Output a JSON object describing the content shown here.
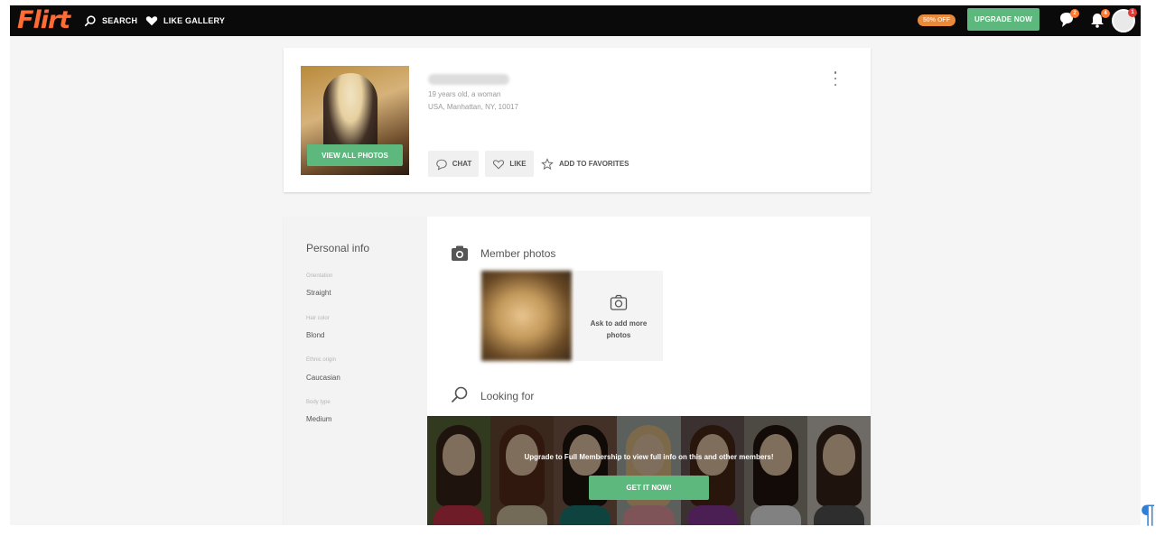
{
  "topbar": {
    "logo_text": "Flirt",
    "nav": [
      {
        "label": "SEARCH",
        "icon": "search-icon"
      },
      {
        "label": "LIKE GALLERY",
        "icon": "heart-icon"
      }
    ],
    "promo_badge": "50% OFF",
    "upgrade_label": "UPGRADE NOW",
    "messages_count": "2",
    "notifications_count": "4",
    "profile_badge": "1",
    "brand_color": "#ff6b35",
    "accent_color": "#5cb87c"
  },
  "profile": {
    "view_photos_label": "VIEW ALL PHOTOS",
    "age_line": "19 years old, a woman",
    "location_line": "USA, Manhattan, NY, 10017",
    "actions": {
      "chat_label": "CHAT",
      "like_label": "LIKE",
      "favorites_label": "ADD TO FAVORITES"
    }
  },
  "personal_info": {
    "title": "Personal info",
    "fields": [
      {
        "label": "Orientation",
        "value": "Straight"
      },
      {
        "label": "Hair color",
        "value": "Blond"
      },
      {
        "label": "Ethnic origin",
        "value": "Caucasian"
      },
      {
        "label": "Body type",
        "value": "Medium"
      }
    ]
  },
  "member_photos": {
    "title": "Member photos",
    "ask_text": "Ask to add more photos"
  },
  "looking_for": {
    "title": "Looking for",
    "upgrade_text": "Upgrade to Full Membership to view full info on this and other members!",
    "cta_label": "GET IT NOW!"
  }
}
